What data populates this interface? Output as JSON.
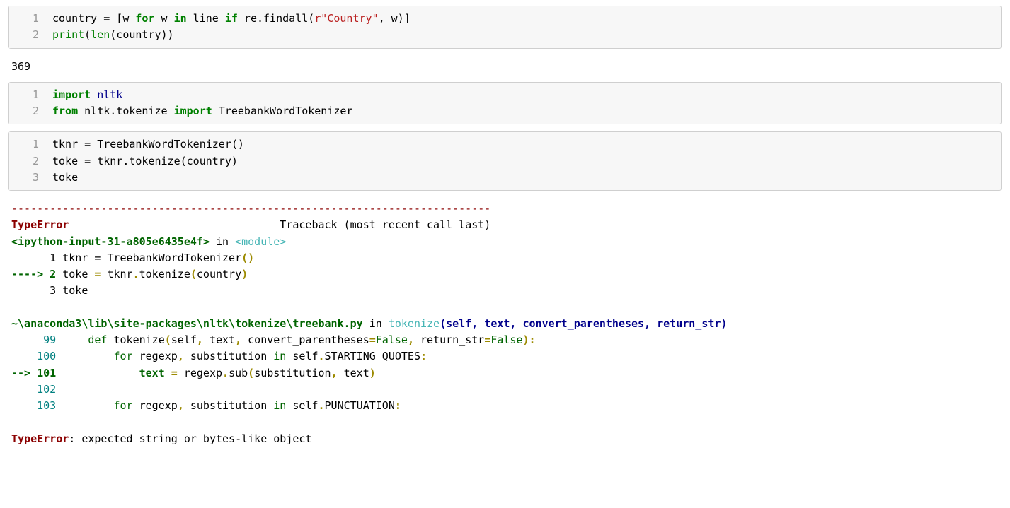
{
  "cells": [
    {
      "gutter": [
        "1",
        "2"
      ],
      "code_html": "country = [w <span class='kw'>for</span> w <span class='kw'>in</span> line <span class='kw'>if</span> re.findall(<span class='str'>r&quot;Country&quot;</span>, w)]\n<span class='bi'>print</span>(<span class='bi'>len</span>(country))"
    }
  ],
  "output1": "369",
  "cells2": [
    {
      "gutter": [
        "1",
        "2"
      ],
      "code_html": "<span class='kw'>import</span> <span class='tb-blue' style='font-weight:normal;color:#00008B'>nltk</span>\n<span class='kw'>from</span> nltk.tokenize <span class='kw'>import</span> TreebankWordTokenizer"
    },
    {
      "gutter": [
        "1",
        "2",
        "3"
      ],
      "code_html": "tknr = TreebankWordTokenizer()\ntoke = tknr.tokenize(country)\ntoke"
    }
  ],
  "traceback": {
    "sep": "---------------------------------------------------------------------------",
    "errname": "TypeError",
    "trailtext": "                                 Traceback (most recent call last)",
    "frame1_loc": "<ipython-input-31-a805e6435e4f>",
    "in_word": " in ",
    "module": "<module>",
    "l1": "      1 tknr = TreebankWordTokenizer",
    "l1b": "()",
    "arrow2": "----> 2 ",
    "l2a": "toke ",
    "l2eq": "=",
    "l2b": " tknr",
    "l2dot1": ".",
    "l2c": "tokenize",
    "l2p1": "(",
    "l2d": "country",
    "l2p2": ")",
    "l3": "      3 toke",
    "blank": "",
    "frame2_loc": "~\\anaconda3\\lib\\site-packages\\nltk\\tokenize\\treebank.py",
    "frame2_func": "tokenize",
    "frame2_sig": "(self, text, convert_parentheses, return_str)",
    "f2_99": "     99     ",
    "f2_99b": "def",
    "f2_99c": " tokenize",
    "f2_99d": "(",
    "f2_99e": "self",
    "f2_99f": ",",
    "f2_99g": " text",
    "f2_99h": ",",
    "f2_99i": " convert_parentheses",
    "f2_99j": "=",
    "f2_99k": "False",
    "f2_99l": ",",
    "f2_99m": " return_str",
    "f2_99n": "=",
    "f2_99o": "False",
    "f2_99p": ")",
    "f2_99q": ":",
    "f2_100a": "    100         ",
    "f2_100b": "for",
    "f2_100c": " regexp",
    "f2_100d": ",",
    "f2_100e": " substitution ",
    "f2_100f": "in",
    "f2_100g": " self",
    "f2_100h": ".",
    "f2_100i": "STARTING_QUOTES",
    "f2_100j": ":",
    "f2_101a": "--> 101             text ",
    "f2_101b": "=",
    "f2_101c": " regexp",
    "f2_101d": ".",
    "f2_101e": "sub",
    "f2_101f": "(",
    "f2_101g": "substitution",
    "f2_101h": ",",
    "f2_101i": " text",
    "f2_101j": ")",
    "f2_102": "    102 ",
    "f2_103a": "    103         ",
    "f2_103b": "for",
    "f2_103c": " regexp",
    "f2_103d": ",",
    "f2_103e": " substitution ",
    "f2_103f": "in",
    "f2_103g": " self",
    "f2_103h": ".",
    "f2_103i": "PUNCTUATION",
    "f2_103j": ":",
    "final_err": "TypeError",
    "final_msg": ": expected string or bytes-like object"
  }
}
